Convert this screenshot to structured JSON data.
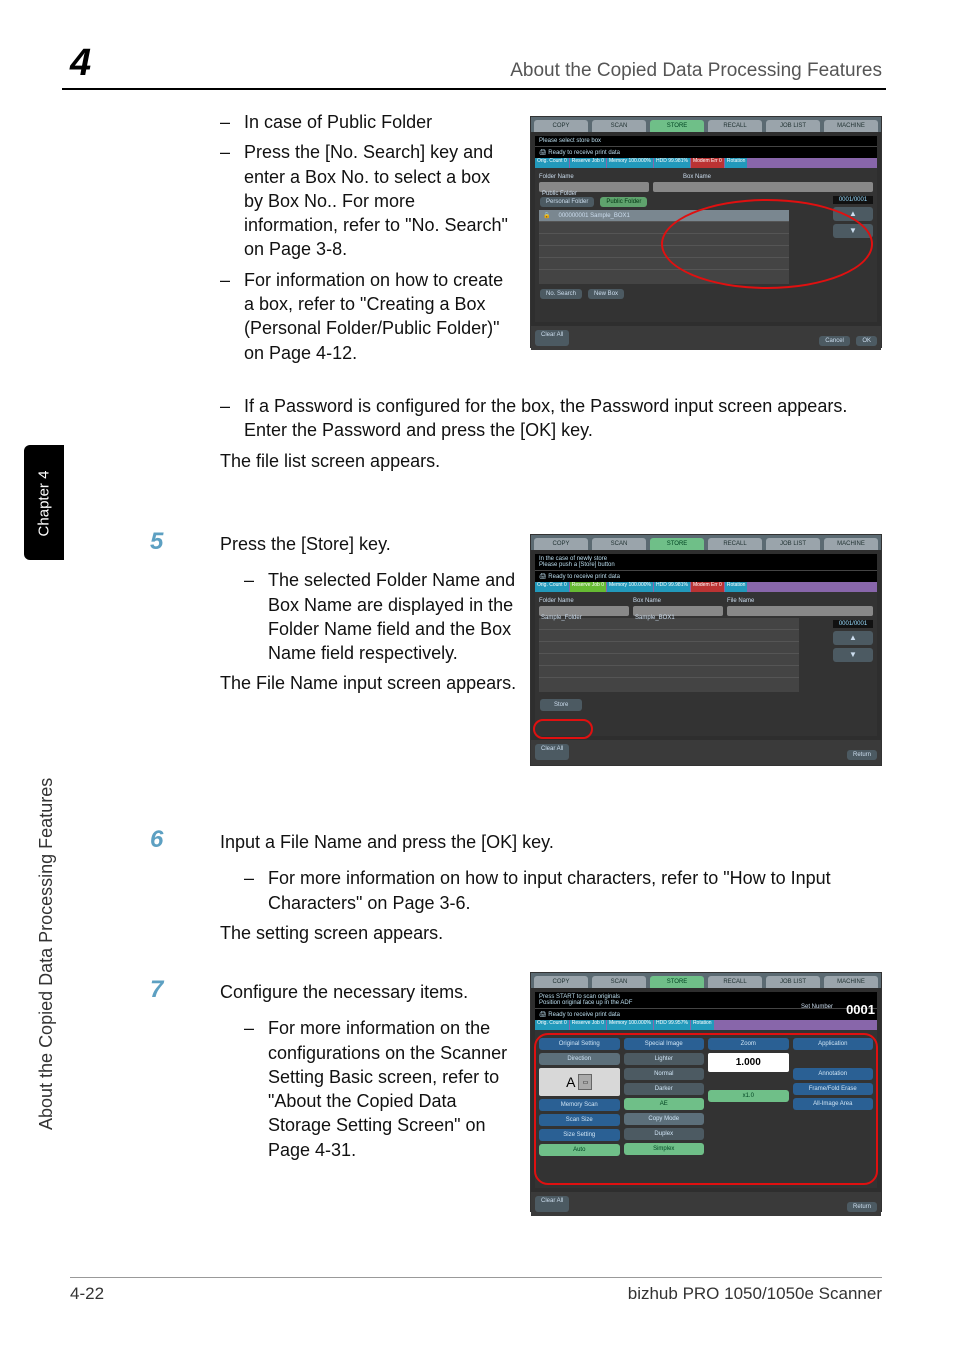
{
  "header": {
    "chapter_number": "4",
    "running_title": "About the Copied Data Processing Features"
  },
  "sidetab": {
    "chapter_label": "Chapter 4",
    "section_label": "About the Copied Data Processing Features"
  },
  "body": {
    "b1": "In case of Public Folder",
    "b2": "Press the [No. Search] key and enter a Box No. to select a box by Box No.. For more information, refer to \"No. Search\" on Page 3-8.",
    "b3": "For information on how to create a box, refer to \"Creating a Box (Personal Folder/Public Folder)\" on Page 4-12.",
    "b4": "If a Password is configured for the box, the Password input screen appears. Enter the Password and press the [OK] key.",
    "b5_result": "The file list screen appears.",
    "step5_num": "5",
    "step5_text": "Press the [Store] key.",
    "step5_b1": "The selected Folder Name and Box Name are displayed in the Folder Name field and the Box Name field respectively.",
    "step5_result": "The File Name input screen appears.",
    "step6_num": "6",
    "step6_text": "Input a File Name and press the [OK] key.",
    "step6_b1": "For more information on how to input characters, refer to \"How to Input Characters\" on Page 3-6.",
    "step6_result": "The setting screen appears.",
    "step7_num": "7",
    "step7_text": "Configure the necessary items.",
    "step7_b1": "For more information on the configurations on the Scanner Setting Basic screen, refer to \"About the Copied Data Storage Setting Screen\" on Page 4-31."
  },
  "shot1": {
    "tabs": [
      "COPY",
      "SCAN",
      "STORE",
      "RECALL",
      "JOB LIST",
      "MACHINE"
    ],
    "msg": "Please select store box",
    "ready": "Ready to receive print data",
    "status": [
      "Orig. Count 0",
      "Reserve Job 0",
      "Memory 100.000%",
      "HDD 99.981%",
      "Modem Err 0",
      "Rotation"
    ],
    "folder_label": "Folder Name",
    "box_label": "Box Name",
    "public_folder": "Public Folder",
    "personal_tab": "Personal Folder",
    "public_tab": "Public Folder",
    "list_item": "000000001 Sample_BOX1",
    "pager": "0001/0001",
    "no_search": "No. Search",
    "new_box": "New Box",
    "clear_all": "Clear All",
    "cancel": "Cancel",
    "ok": "OK"
  },
  "shot2": {
    "tabs": [
      "COPY",
      "SCAN",
      "STORE",
      "RECALL",
      "JOB LIST",
      "MACHINE"
    ],
    "msg1": "In the case of newly store",
    "msg2": "Please push a [Store] button",
    "ready": "Ready to receive print data",
    "status": [
      "Orig. Count 0",
      "Reserve Job 0",
      "Memory 100.000%",
      "HDD 99.981%",
      "Modem Err 0",
      "Rotation"
    ],
    "folder_label": "Folder Name",
    "box_label": "Box Name",
    "file_label": "File Name",
    "folder_val": "Sample_Folder",
    "box_val": "Sample_BOX1",
    "pager": "0001/0001",
    "store": "Store",
    "clear_all": "Clear All",
    "return": "Return"
  },
  "shot3": {
    "tabs": [
      "COPY",
      "SCAN",
      "STORE",
      "RECALL",
      "JOB LIST",
      "MACHINE"
    ],
    "msg1": "Press START to scan originals",
    "msg2": "Position original face up in the ADF",
    "ready": "Ready to receive print data",
    "set_label": "Set Number",
    "set_value": "0001",
    "status": [
      "Orig. Count 0",
      "Reserve Job 0",
      "Memory 100.000%",
      "HDD 99.957%",
      "Rotation"
    ],
    "col1_h": "Original Setting",
    "col2_h": "Special Image",
    "col3_h": "Zoom",
    "col4_h": "Application",
    "direction": "Direction",
    "dir_val": "A",
    "lighter": "Lighter",
    "normal": "Normal",
    "darker": "Darker",
    "zoom_val": "1.000",
    "annotation": "Annotation",
    "framefold": "Frame/Fold Erase",
    "memory_scan": "Memory Scan",
    "ae": "AE",
    "x10": "x1.0",
    "allimage": "All-Image Area",
    "scan_size": "Scan Size",
    "copy_mode": "Copy Mode",
    "size_setting": "Size Setting",
    "duplex": "Duplex",
    "auto": "Auto",
    "simplex": "Simplex",
    "clear_all": "Clear All",
    "return": "Return"
  },
  "footer": {
    "page": "4-22",
    "product": "bizhub PRO 1050/1050e Scanner"
  }
}
